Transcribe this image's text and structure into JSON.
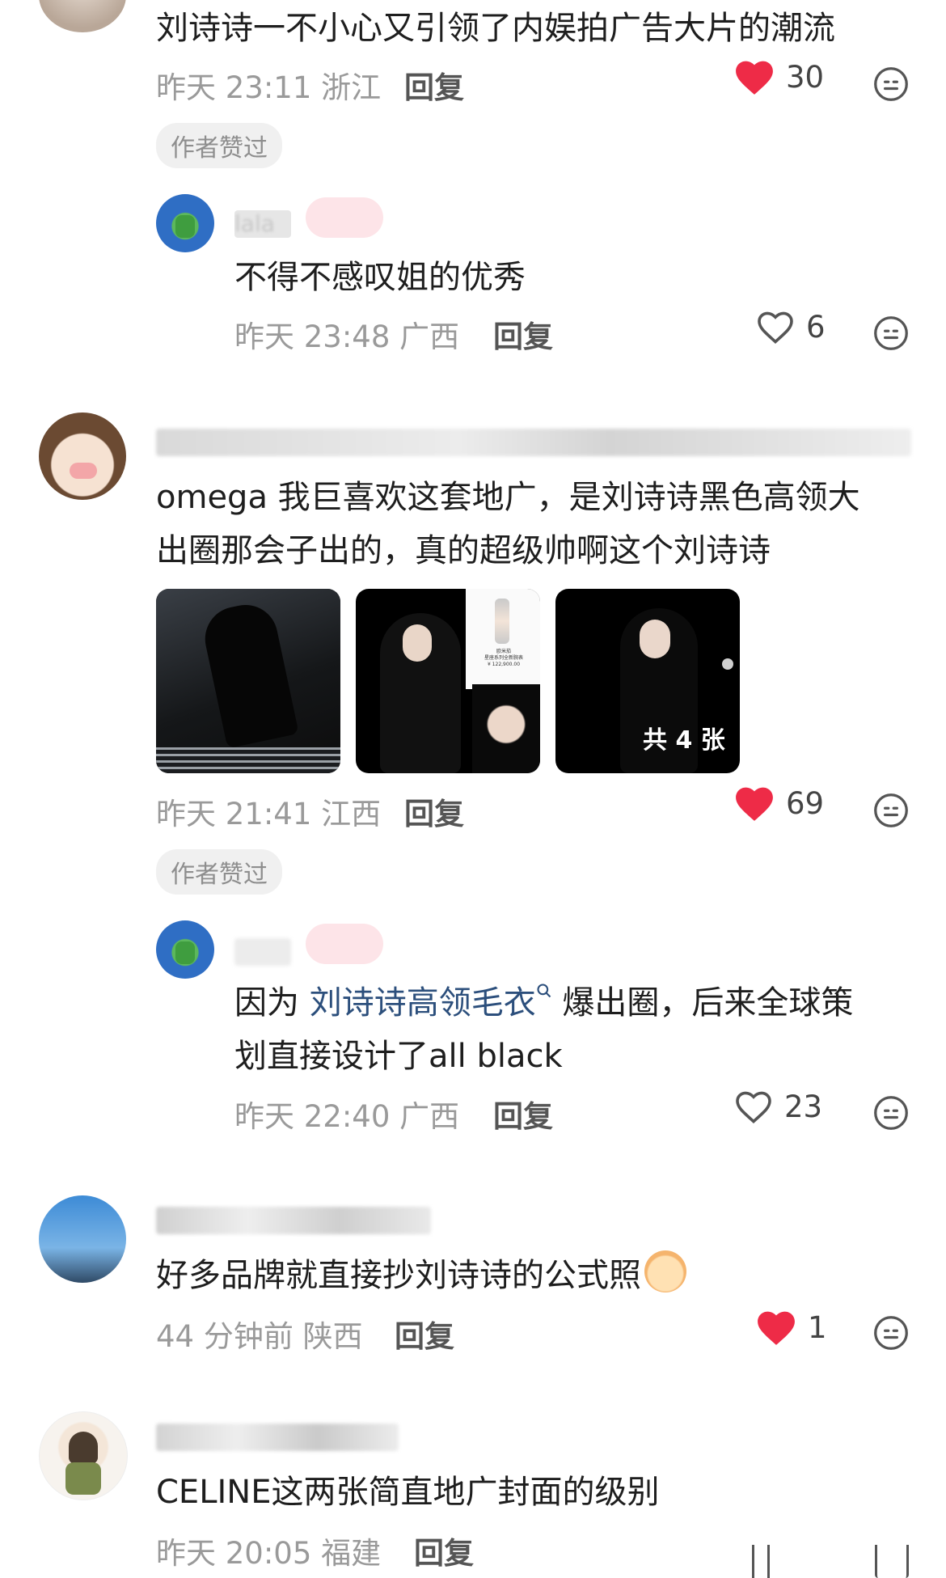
{
  "comments": [
    {
      "text": "刘诗诗一不小心又引领了内娱拍广告大片的潮流",
      "time": "昨天 23:11",
      "location": "浙江",
      "reply_label": "回复",
      "likes": "30",
      "liked": true,
      "badge": "作者赞过",
      "replies": [
        {
          "username": "lala",
          "text": "不得不感叹姐的优秀",
          "time": "昨天 23:48",
          "location": "广西",
          "reply_label": "回复",
          "likes": "6",
          "liked": false
        }
      ]
    },
    {
      "text_line1": "omega 我巨喜欢这套地广，是刘诗诗黑色高领大",
      "text_line2": "出圈那会子出的，真的超级帅啊这个刘诗诗",
      "images_count_label": "共 4 张",
      "watch_text": "欧米茄\n星座系列全新腕表\n¥ 122,900.00",
      "time": "昨天 21:41",
      "location": "江西",
      "reply_label": "回复",
      "likes": "69",
      "liked": true,
      "badge": "作者赞过",
      "replies": [
        {
          "text_prefix": "因为 ",
          "text_link": "刘诗诗高领毛衣",
          "text_suffix": " 爆出圈，后来全球策",
          "text_line2": "划直接设计了all black",
          "time": "昨天 22:40",
          "location": "广西",
          "reply_label": "回复",
          "likes": "23",
          "liked": false
        }
      ]
    },
    {
      "text": "好多品牌就直接抄刘诗诗的公式照",
      "time": "44 分钟前",
      "location": "陕西",
      "reply_label": "回复",
      "likes": "1",
      "liked": true
    },
    {
      "text": "CELINE这两张简直地广封面的级别",
      "time": "昨天 20:05",
      "location": "福建",
      "reply_label": "回复"
    }
  ],
  "colors": {
    "like_red": "#ee2b47",
    "meta_gray": "#9a9a9a",
    "link_blue": "#2c4f7c"
  },
  "icons": [
    "heart-filled-icon",
    "heart-outline-icon",
    "smiley-icon",
    "search-icon"
  ]
}
